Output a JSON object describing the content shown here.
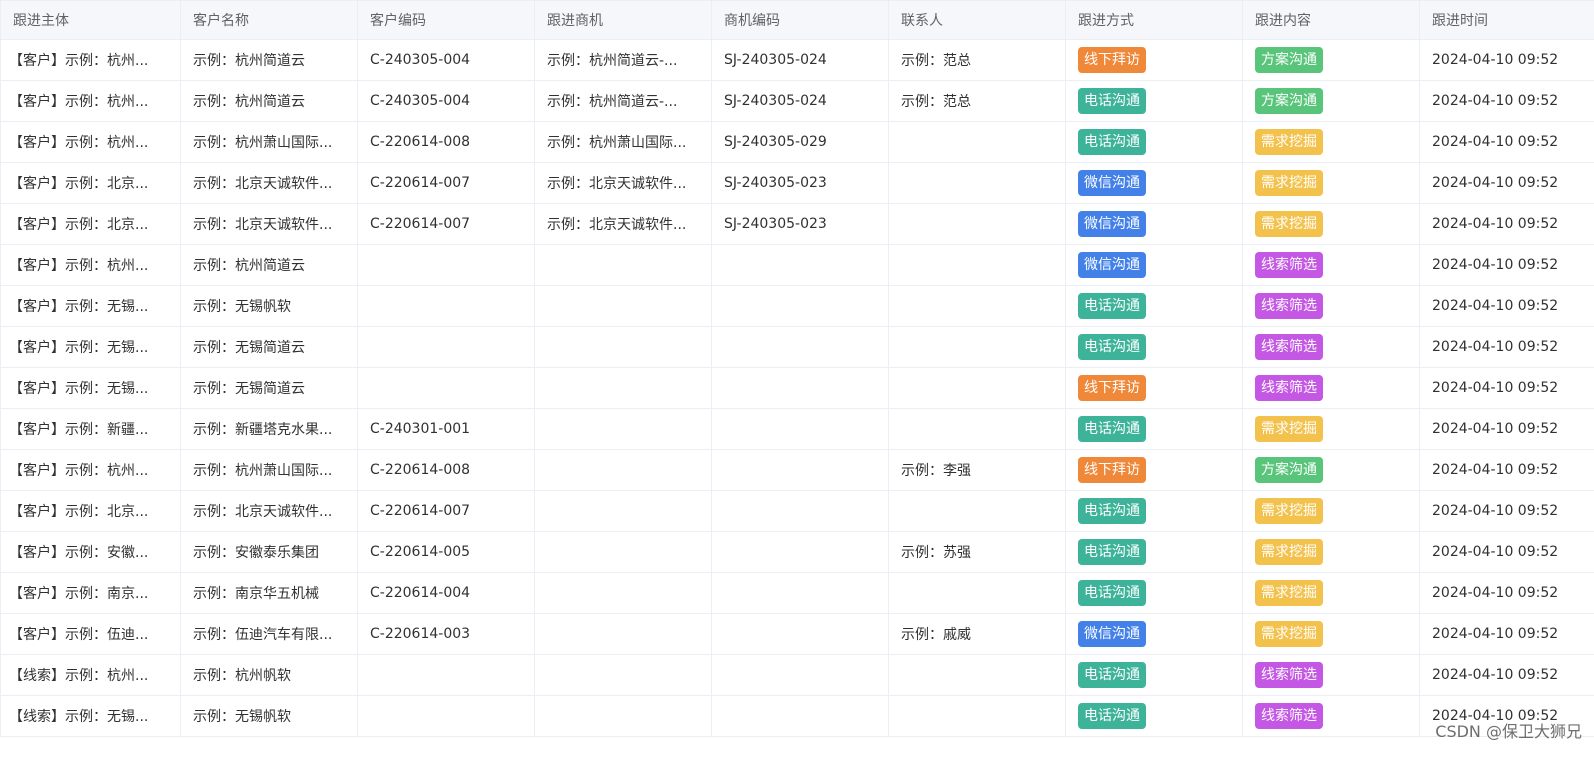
{
  "columns": [
    "跟进主体",
    "客户名称",
    "客户编码",
    "跟进商机",
    "商机编码",
    "联系人",
    "跟进方式",
    "跟进内容",
    "跟进时间"
  ],
  "tag_colors": {
    "线下拜访": "#f0883a",
    "电话沟通": "#3db39a",
    "微信沟通": "#4381e8",
    "方案沟通": "#58c57b",
    "需求挖掘": "#f3c24d",
    "线索筛选": "#c457e3"
  },
  "rows": [
    [
      "【客户】示例：杭州...",
      "示例：杭州简道云",
      "C-240305-004",
      "示例：杭州简道云-...",
      "SJ-240305-024",
      "示例：范总",
      "线下拜访",
      "方案沟通",
      "2024-04-10 09:52"
    ],
    [
      "【客户】示例：杭州...",
      "示例：杭州简道云",
      "C-240305-004",
      "示例：杭州简道云-...",
      "SJ-240305-024",
      "示例：范总",
      "电话沟通",
      "方案沟通",
      "2024-04-10 09:52"
    ],
    [
      "【客户】示例：杭州...",
      "示例：杭州萧山国际...",
      "C-220614-008",
      "示例：杭州萧山国际...",
      "SJ-240305-029",
      "",
      "电话沟通",
      "需求挖掘",
      "2024-04-10 09:52"
    ],
    [
      "【客户】示例：北京...",
      "示例：北京天诚软件...",
      "C-220614-007",
      "示例：北京天诚软件...",
      "SJ-240305-023",
      "",
      "微信沟通",
      "需求挖掘",
      "2024-04-10 09:52"
    ],
    [
      "【客户】示例：北京...",
      "示例：北京天诚软件...",
      "C-220614-007",
      "示例：北京天诚软件...",
      "SJ-240305-023",
      "",
      "微信沟通",
      "需求挖掘",
      "2024-04-10 09:52"
    ],
    [
      "【客户】示例：杭州...",
      "示例：杭州简道云",
      "",
      "",
      "",
      "",
      "微信沟通",
      "线索筛选",
      "2024-04-10 09:52"
    ],
    [
      "【客户】示例：无锡...",
      "示例：无锡帆软",
      "",
      "",
      "",
      "",
      "电话沟通",
      "线索筛选",
      "2024-04-10 09:52"
    ],
    [
      "【客户】示例：无锡...",
      "示例：无锡简道云",
      "",
      "",
      "",
      "",
      "电话沟通",
      "线索筛选",
      "2024-04-10 09:52"
    ],
    [
      "【客户】示例：无锡...",
      "示例：无锡简道云",
      "",
      "",
      "",
      "",
      "线下拜访",
      "线索筛选",
      "2024-04-10 09:52"
    ],
    [
      "【客户】示例：新疆...",
      "示例：新疆塔克水果...",
      "C-240301-001",
      "",
      "",
      "",
      "电话沟通",
      "需求挖掘",
      "2024-04-10 09:52"
    ],
    [
      "【客户】示例：杭州...",
      "示例：杭州萧山国际...",
      "C-220614-008",
      "",
      "",
      "示例：李强",
      "线下拜访",
      "方案沟通",
      "2024-04-10 09:52"
    ],
    [
      "【客户】示例：北京...",
      "示例：北京天诚软件...",
      "C-220614-007",
      "",
      "",
      "",
      "电话沟通",
      "需求挖掘",
      "2024-04-10 09:52"
    ],
    [
      "【客户】示例：安徽...",
      "示例：安徽泰乐集团",
      "C-220614-005",
      "",
      "",
      "示例：苏强",
      "电话沟通",
      "需求挖掘",
      "2024-04-10 09:52"
    ],
    [
      "【客户】示例：南京...",
      "示例：南京华五机械",
      "C-220614-004",
      "",
      "",
      "",
      "电话沟通",
      "需求挖掘",
      "2024-04-10 09:52"
    ],
    [
      "【客户】示例：伍迪...",
      "示例：伍迪汽车有限...",
      "C-220614-003",
      "",
      "",
      "示例：戚威",
      "微信沟通",
      "需求挖掘",
      "2024-04-10 09:52"
    ],
    [
      "【线索】示例：杭州...",
      "示例：杭州帆软",
      "",
      "",
      "",
      "",
      "电话沟通",
      "线索筛选",
      "2024-04-10 09:52"
    ],
    [
      "【线索】示例：无锡...",
      "示例：无锡帆软",
      "",
      "",
      "",
      "",
      "电话沟通",
      "线索筛选",
      "2024-04-10 09:52"
    ]
  ],
  "watermark": "CSDN @保卫大狮兄"
}
